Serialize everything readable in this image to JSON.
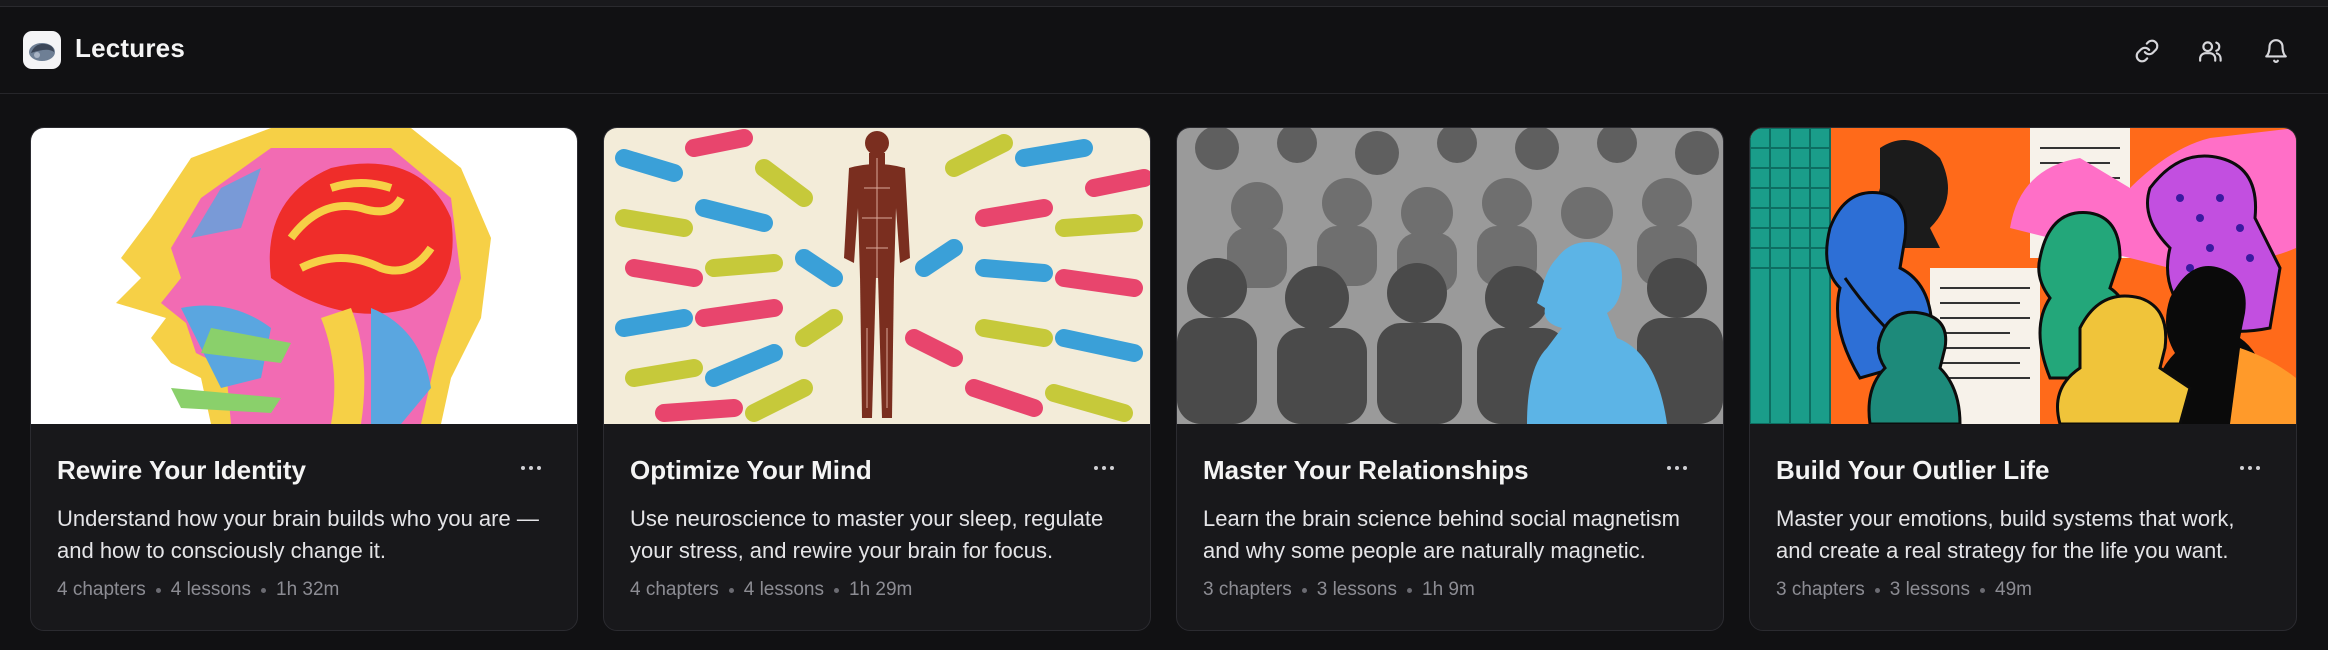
{
  "header": {
    "title": "Lectures",
    "icons": [
      "link-icon",
      "users-icon",
      "bell-icon"
    ]
  },
  "courses": [
    {
      "title": "Rewire Your Identity",
      "description": "Understand how your brain builds who you are — and how to consciously change it.",
      "chapters": "4 chapters",
      "lessons": "4 lessons",
      "duration": "1h 32m"
    },
    {
      "title": "Optimize Your Mind",
      "description": "Use neuroscience to master your sleep, regulate your stress, and rewire your brain for focus.",
      "chapters": "4 chapters",
      "lessons": "4 lessons",
      "duration": "1h 29m"
    },
    {
      "title": "Master Your Relationships",
      "description": "Learn the brain science behind social magnetism and why some people are naturally magnetic.",
      "chapters": "3 chapters",
      "lessons": "3 lessons",
      "duration": "1h 9m"
    },
    {
      "title": "Build Your Outlier Life",
      "description": "Master your emotions, build systems that work, and create a real strategy for the life you want.",
      "chapters": "3 chapters",
      "lessons": "3 lessons",
      "duration": "49m"
    }
  ],
  "colors": {
    "background": "#111113",
    "card": "#18181b",
    "border": "#2b2b30",
    "muted_text": "#8c8c93"
  }
}
